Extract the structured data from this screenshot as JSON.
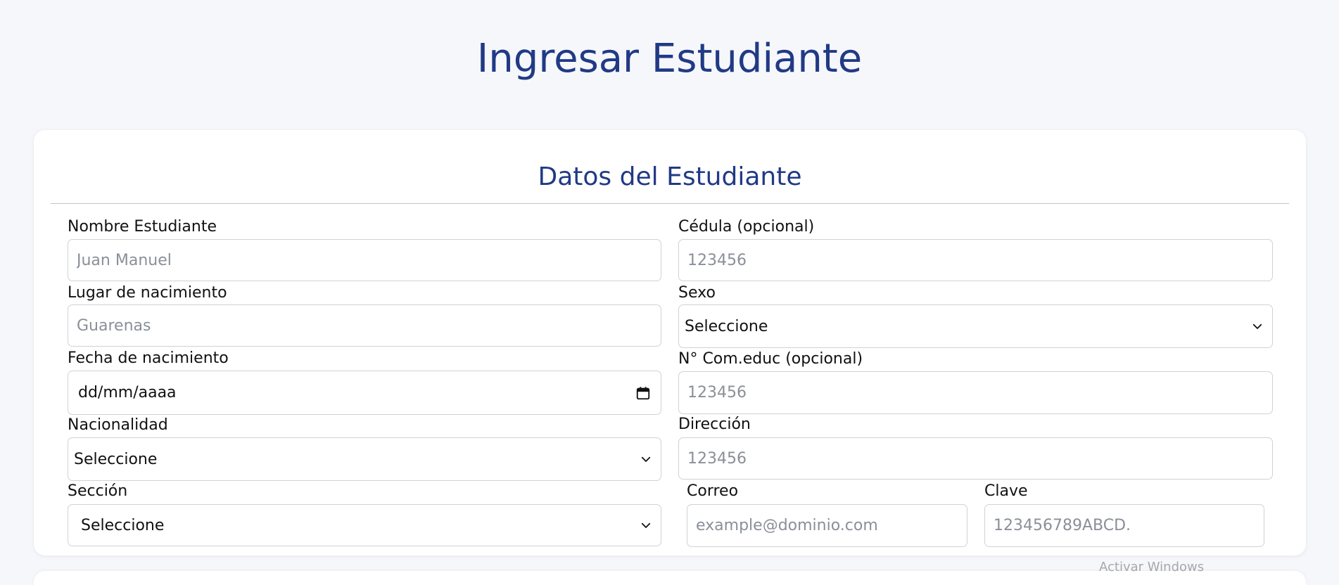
{
  "page": {
    "title": "Ingresar Estudiante"
  },
  "card": {
    "title": "Datos del Estudiante"
  },
  "fields": {
    "nombre": {
      "label": "Nombre Estudiante",
      "placeholder": "Juan Manuel"
    },
    "cedula": {
      "label": "Cédula (opcional)",
      "placeholder": "123456"
    },
    "lugar": {
      "label": "Lugar de nacimiento",
      "placeholder": "Guarenas"
    },
    "sexo": {
      "label": "Sexo",
      "value": "Seleccione"
    },
    "fecha": {
      "label": "Fecha de nacimiento",
      "value": "dd/mm/aaaa"
    },
    "comeduc": {
      "label": "N° Com.educ (opcional)",
      "placeholder": "123456"
    },
    "nacionalidad": {
      "label": "Nacionalidad",
      "value": "Seleccione"
    },
    "direccion": {
      "label": "Dirección",
      "placeholder": "123456"
    },
    "seccion": {
      "label": "Sección",
      "value": "Seleccione"
    },
    "correo": {
      "label": "Correo",
      "placeholder": "example@dominio.com"
    },
    "clave": {
      "label": "Clave",
      "placeholder": "123456789ABCD."
    }
  },
  "overlay": {
    "watermark": "Activar Windows"
  },
  "icons": {
    "select_arrow": "chevron-down-icon",
    "date_picker": "calendar-icon"
  },
  "colors": {
    "heading": "#213a86",
    "background": "#f6f7fb",
    "card": "#ffffff",
    "border": "#cfd2d8",
    "placeholder": "#8a8f98"
  }
}
